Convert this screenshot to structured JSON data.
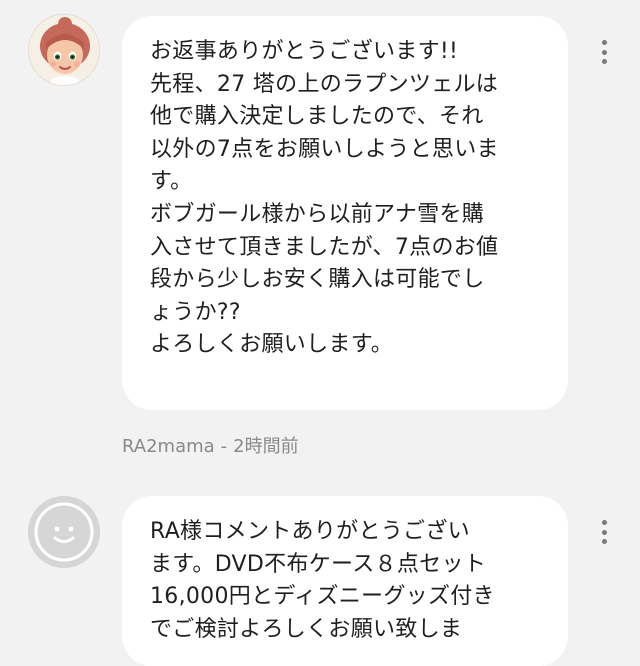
{
  "comments": [
    {
      "avatar_icon": "doll-face-avatar-icon",
      "text": "お返事ありがとうございます!!\n先程、27 塔の上のラプンツェルは\n他で購入決定しましたので、それ\n以外の7点をお願いしようと思いま\nす。\nボブガール様から以前アナ雪を購\n入させて頂きましたが、7点のお値\n段から少しお安く購入は可能でし\nょうか??\nよろしくお願いします。",
      "author": "RA2mama",
      "time": "2時間前",
      "menu_icon": "more-vertical-icon"
    },
    {
      "avatar_icon": "default-smiley-avatar-icon",
      "text": "RA様コメントありがとうござい\nます。DVD不布ケース８点セット\n16,000円とディズニーグッズ付き\nでご検討よろしくお願い致しま",
      "menu_icon": "more-vertical-icon"
    }
  ],
  "colors": {
    "background": "#f2f2f2",
    "bubble": "#ffffff",
    "meta_text": "#8a8a8a",
    "icon_gray": "#7a7a7a"
  }
}
